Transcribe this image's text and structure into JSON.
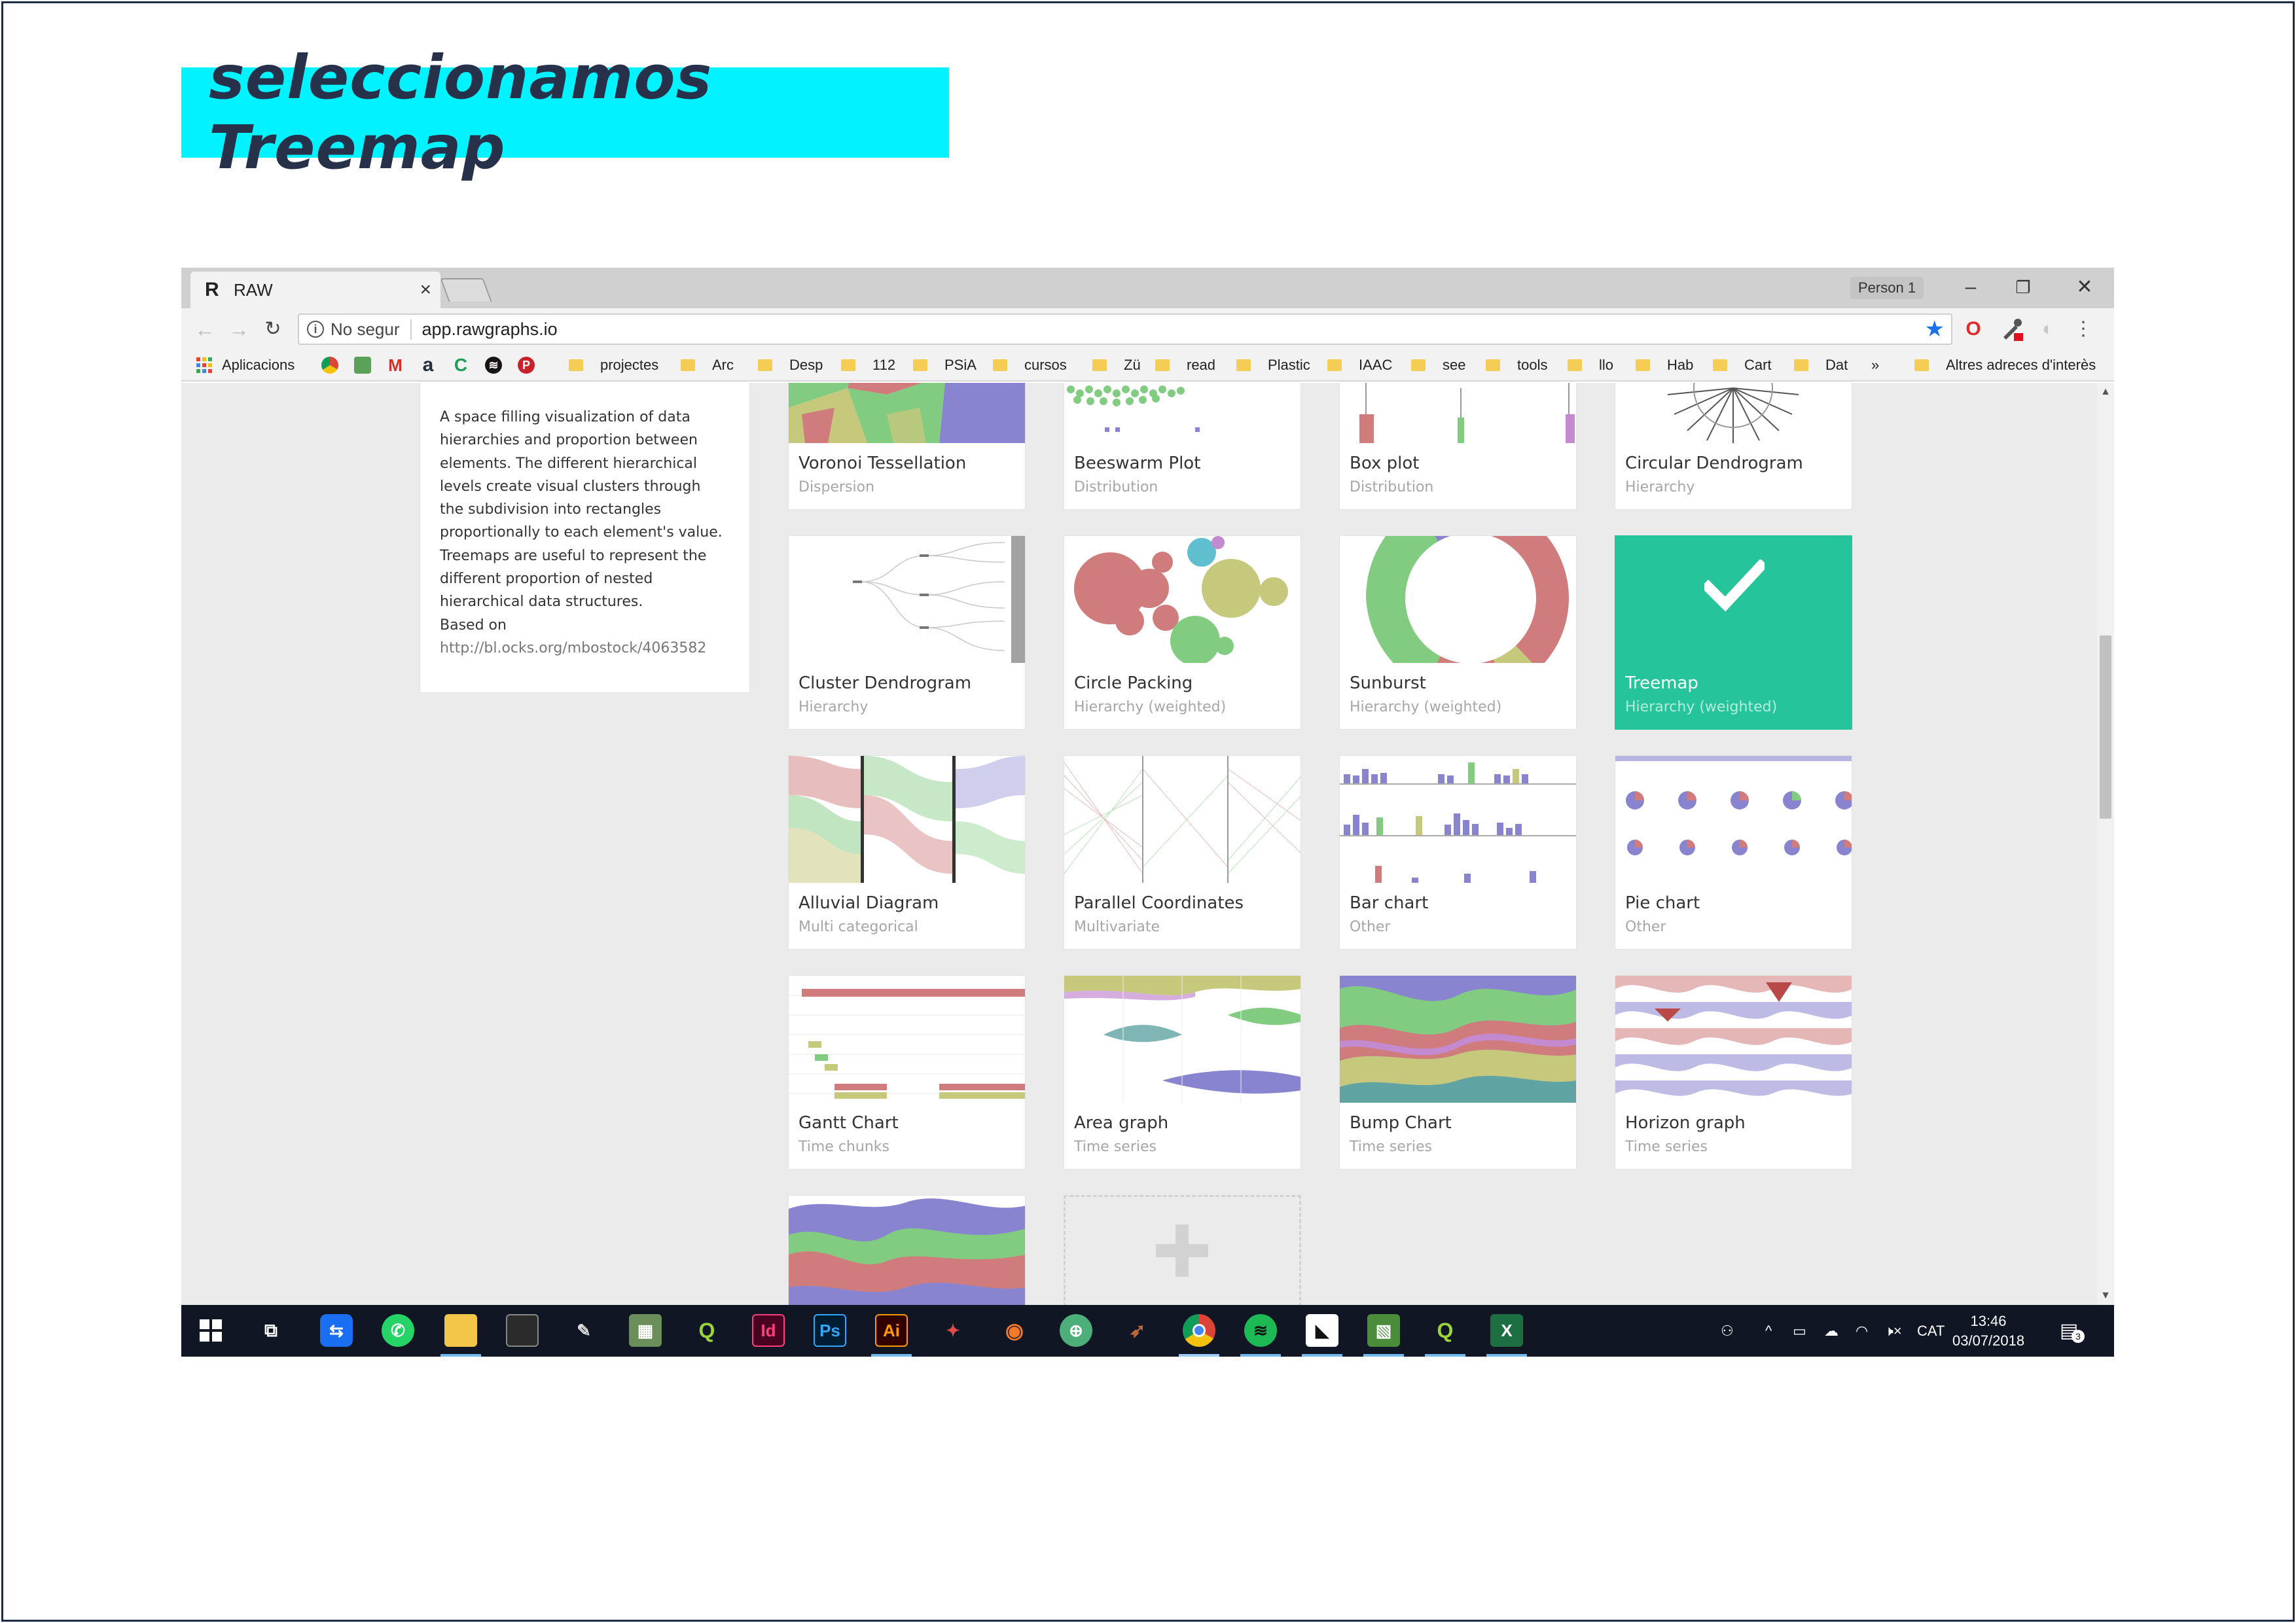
{
  "slide": {
    "title": "seleccionamos Treemap"
  },
  "browser": {
    "tab_title": "RAW",
    "tab_favicon": "R",
    "profile_label": "Person 1",
    "not_secure": "No segur",
    "url": "app.rawgraphs.io",
    "bookmarks": {
      "apps": "Aplicacions",
      "folders": [
        "projectes",
        "Arc",
        "Desp",
        "112",
        "PSiA",
        "cursos",
        "Zü",
        "read",
        "Plastic",
        "IAAC",
        "see",
        "tools",
        "llo",
        "Hab",
        "Cart",
        "Dat"
      ],
      "more": "»",
      "other": "Altres adreces d'interès"
    }
  },
  "description": {
    "lines": [
      "A space filling visualization of data",
      "hierarchies and proportion between",
      "elements. The different hierarchical",
      "levels create visual clusters through",
      "the subdivision into rectangles",
      "proportionally to each element's value.",
      "Treemaps are useful to represent the",
      "different proportion of nested",
      "hierarchical data structures."
    ],
    "based_on": "Based on",
    "link": "http://bl.ocks.org/mbostock/4063582"
  },
  "charts": [
    {
      "name": "Voronoi Tessellation",
      "category": "Dispersion"
    },
    {
      "name": "Beeswarm Plot",
      "category": "Distribution"
    },
    {
      "name": "Box plot",
      "category": "Distribution"
    },
    {
      "name": "Circular Dendrogram",
      "category": "Hierarchy"
    },
    {
      "name": "Cluster Dendrogram",
      "category": "Hierarchy"
    },
    {
      "name": "Circle Packing",
      "category": "Hierarchy (weighted)"
    },
    {
      "name": "Sunburst",
      "category": "Hierarchy (weighted)"
    },
    {
      "name": "Treemap",
      "category": "Hierarchy (weighted)",
      "selected": true
    },
    {
      "name": "Alluvial Diagram",
      "category": "Multi categorical"
    },
    {
      "name": "Parallel Coordinates",
      "category": "Multivariate"
    },
    {
      "name": "Bar chart",
      "category": "Other"
    },
    {
      "name": "Pie chart",
      "category": "Other"
    },
    {
      "name": "Gantt Chart",
      "category": "Time chunks"
    },
    {
      "name": "Area graph",
      "category": "Time series"
    },
    {
      "name": "Bump Chart",
      "category": "Time series"
    },
    {
      "name": "Horizon graph",
      "category": "Time series"
    }
  ],
  "taskbar": {
    "lang": "CAT",
    "time": "13:46",
    "date": "03/07/2018",
    "notifications": "3",
    "icons": [
      "windows-start-icon",
      "task-view-icon",
      "teamviewer-icon",
      "whatsapp-icon",
      "file-explorer-icon",
      "terminal-icon",
      "inkscape-icon",
      "image-viewer-icon",
      "qgis-icon",
      "indesign-icon",
      "photoshop-icon",
      "illustrator-icon",
      "app-icon",
      "blender-icon",
      "globe-icon",
      "rhino-icon",
      "chrome-icon",
      "spotify-icon",
      "sticky-notes-icon",
      "photos-icon",
      "qgis-icon-2",
      "excel-icon"
    ]
  },
  "colors": {
    "accent_cyan": "#00f3ff",
    "selected_green": "#25c49a",
    "raw_red": "#d07c7c",
    "raw_green": "#82cc82",
    "raw_purple": "#8884d0",
    "raw_olive": "#c6c87c"
  }
}
